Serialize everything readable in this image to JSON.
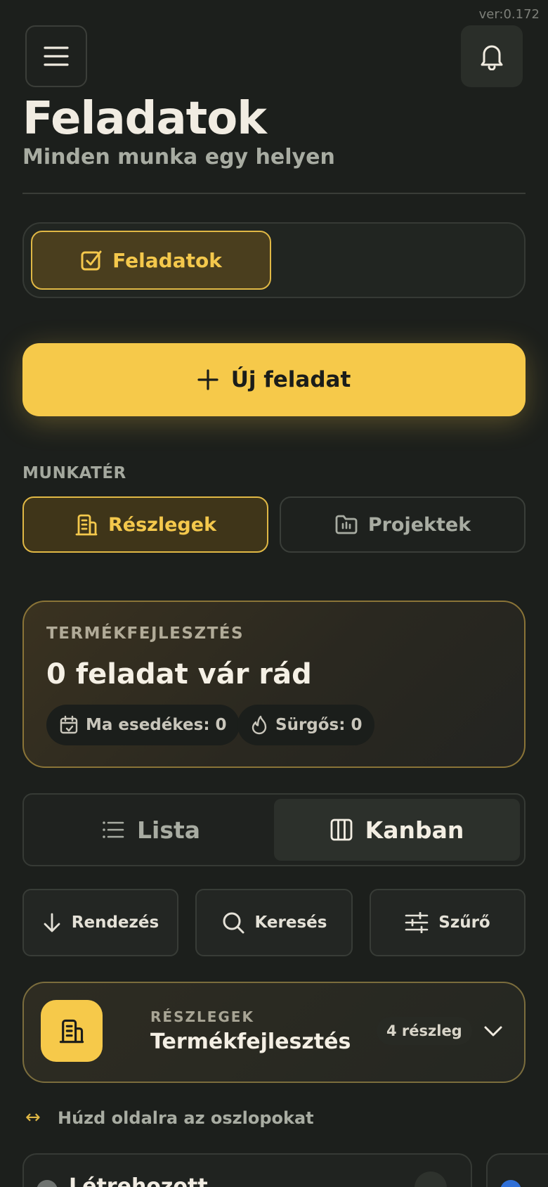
{
  "version": "ver:0.172",
  "header": {
    "title": "Feladatok",
    "subtitle": "Minden munka egy helyen",
    "menu_icon": "hamburger-menu-icon",
    "notification_icon": "bell-icon"
  },
  "main_tabs": [
    {
      "label": "Feladatok",
      "icon": "checkbox-icon",
      "active": true
    }
  ],
  "new_task_button": {
    "label": "Új feladat",
    "icon": "plus-icon"
  },
  "workspace": {
    "label": "MUNKATÉR",
    "options": [
      {
        "label": "Részlegek",
        "icon": "building-icon",
        "active": true
      },
      {
        "label": "Projektek",
        "icon": "folder-icon",
        "active": false
      }
    ]
  },
  "summary": {
    "category": "TERMÉKFEJLESZTÉS",
    "headline": "0 feladat vár rád",
    "chips": [
      {
        "label": "Ma esedékes: 0",
        "icon": "calendar-check-icon"
      },
      {
        "label": "Sürgős: 0",
        "icon": "flame-icon"
      }
    ]
  },
  "view_toggle": [
    {
      "label": "Lista",
      "icon": "list-icon",
      "active": false
    },
    {
      "label": "Kanban",
      "icon": "kanban-icon",
      "active": true
    }
  ],
  "toolbar": [
    {
      "label": "Rendezés",
      "icon": "arrow-down-icon"
    },
    {
      "label": "Keresés",
      "icon": "search-icon"
    },
    {
      "label": "Szűrő",
      "icon": "sliders-icon"
    }
  ],
  "department": {
    "label": "RÉSZLEGEK",
    "name": "Termékfejlesztés",
    "count": "4 részleg",
    "icon": "building-icon"
  },
  "hint": {
    "icon": "horizontal-arrows-icon",
    "glyph": "↔",
    "text": "Húzd oldalra az oszlopokat"
  },
  "columns": [
    {
      "title": "Létrehozott"
    }
  ],
  "colors": {
    "accent": "#f6c94a",
    "background": "#1c1f1c",
    "muted_text": "#a8aca2"
  }
}
